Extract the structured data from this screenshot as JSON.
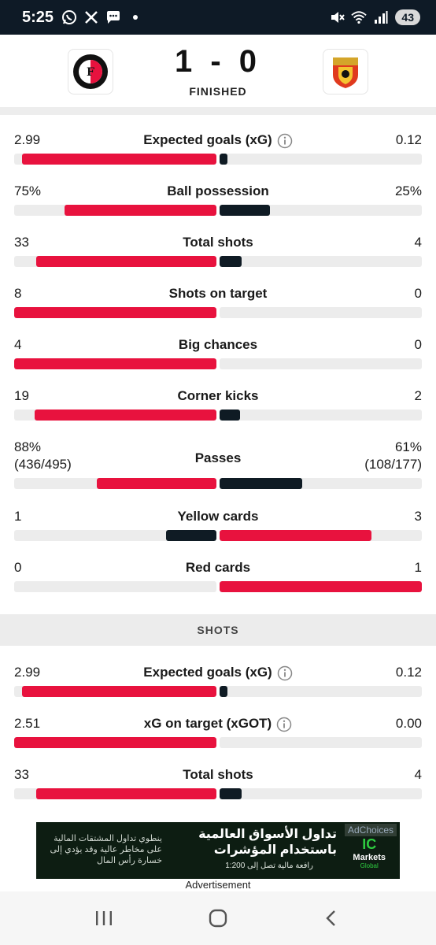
{
  "status_bar": {
    "time": "5:25",
    "battery": "43",
    "left_icons": [
      "whatsapp-icon",
      "x-icon",
      "messages-icon",
      "dot-icon"
    ],
    "right_icons": [
      "mute-icon",
      "wifi-icon",
      "signal-icon"
    ]
  },
  "match": {
    "score": "1 - 0",
    "status": "FINISHED",
    "home_team_logo": "feyenoord-logo",
    "away_team_logo": "go-ahead-eagles-logo"
  },
  "colors": {
    "home": "#e8123e",
    "away": "#0f1b24",
    "track": "#ececec"
  },
  "stats": [
    {
      "label": "Expected goals (xG)",
      "home": "2.99",
      "away": "0.12",
      "info": true,
      "home_frac": 0.96,
      "away_frac": 0.04,
      "home_color": "red",
      "away_color": "dark"
    },
    {
      "label": "Ball possession",
      "home": "75%",
      "away": "25%",
      "info": false,
      "home_frac": 0.75,
      "away_frac": 0.25,
      "home_color": "red",
      "away_color": "dark"
    },
    {
      "label": "Total shots",
      "home": "33",
      "away": "4",
      "info": false,
      "home_frac": 0.89,
      "away_frac": 0.11,
      "home_color": "red",
      "away_color": "dark"
    },
    {
      "label": "Shots on target",
      "home": "8",
      "away": "0",
      "info": false,
      "home_frac": 1.0,
      "away_frac": 0.0,
      "home_color": "red",
      "away_color": "dark"
    },
    {
      "label": "Big chances",
      "home": "4",
      "away": "0",
      "info": false,
      "home_frac": 1.0,
      "away_frac": 0.0,
      "home_color": "red",
      "away_color": "dark"
    },
    {
      "label": "Corner kicks",
      "home": "19",
      "away": "2",
      "info": false,
      "home_frac": 0.9,
      "away_frac": 0.1,
      "home_color": "red",
      "away_color": "dark"
    },
    {
      "label": "Passes",
      "home": "88%",
      "away": "61%",
      "home_sub": "(436/495)",
      "away_sub": "(108/177)",
      "info": false,
      "home_frac": 0.59,
      "away_frac": 0.41,
      "home_color": "red",
      "away_color": "dark"
    },
    {
      "label": "Yellow cards",
      "home": "1",
      "away": "3",
      "info": false,
      "home_frac": 0.25,
      "away_frac": 0.75,
      "home_color": "dark",
      "away_color": "red"
    },
    {
      "label": "Red cards",
      "home": "0",
      "away": "1",
      "info": false,
      "home_frac": 0.0,
      "away_frac": 1.0,
      "home_color": "dark",
      "away_color": "red"
    }
  ],
  "shots_section": {
    "title": "SHOTS",
    "stats": [
      {
        "label": "Expected goals (xG)",
        "home": "2.99",
        "away": "0.12",
        "info": true,
        "home_frac": 0.96,
        "away_frac": 0.04,
        "home_color": "red",
        "away_color": "dark"
      },
      {
        "label": "xG on target (xGOT)",
        "home": "2.51",
        "away": "0.00",
        "info": true,
        "home_frac": 1.0,
        "away_frac": 0.0,
        "home_color": "red",
        "away_color": "dark"
      },
      {
        "label": "Total shots",
        "home": "33",
        "away": "4",
        "info": false,
        "home_frac": 0.89,
        "away_frac": 0.11,
        "home_color": "red",
        "away_color": "dark"
      }
    ]
  },
  "ad": {
    "choices": "AdChoices",
    "headline_1": "تداول الأسواق العالمية",
    "headline_2": "باستخدام المؤشرات",
    "sub": "رافعة مالية تصل إلى 1:200",
    "disclaimer": "ينطوي تداول المشتقات المالية على مخاطر عالية وقد يؤدي إلى خسارة رأس المال",
    "brand_ic": "IC",
    "brand_name": "Markets",
    "brand_sub": "Global",
    "label": "Advertisement"
  },
  "nav": {
    "recents": "recents-icon",
    "home": "home-icon",
    "back": "back-icon"
  }
}
